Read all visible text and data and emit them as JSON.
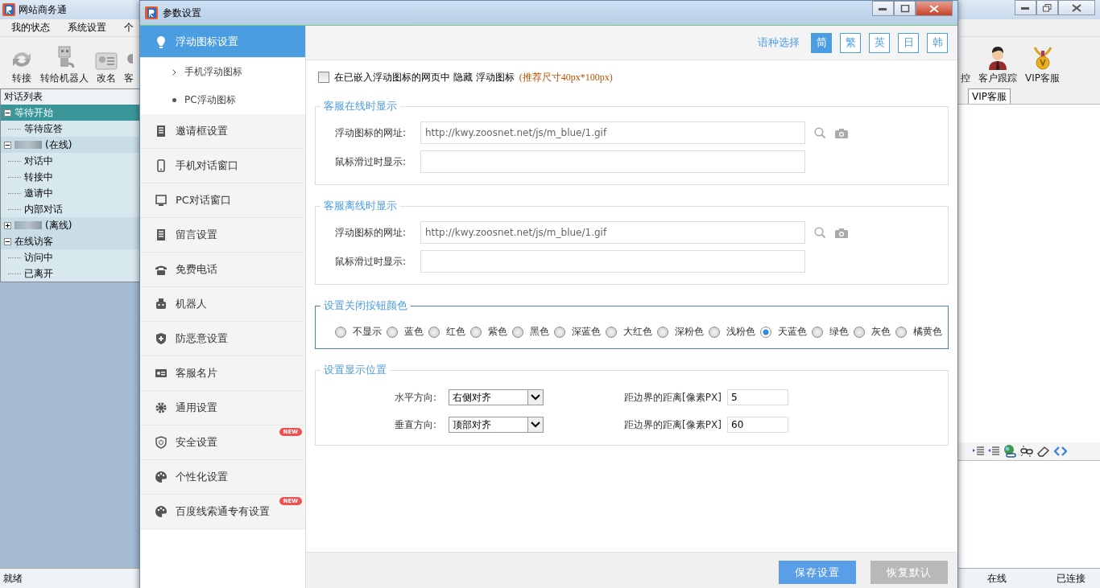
{
  "main_window": {
    "title": "网站商务通",
    "menu": [
      "我的状态",
      "系统设置",
      "个"
    ],
    "toolbar": [
      "转接",
      "转给机器人",
      "改名",
      "客"
    ],
    "toolbar_right": [
      "控",
      "客户跟踪",
      "VIP客服"
    ],
    "conversation_panel": {
      "title": "对话列表",
      "tree": [
        {
          "label": "等待开始",
          "expanded": true,
          "selected": true,
          "redacted": false,
          "children": [
            {
              "label": "等待应答"
            }
          ]
        },
        {
          "label": "(在线)",
          "expanded": true,
          "selected": false,
          "redacted": true,
          "children": [
            {
              "label": "对话中"
            },
            {
              "label": "转接中"
            },
            {
              "label": "邀请中"
            },
            {
              "label": "内部对话"
            }
          ]
        },
        {
          "label": "(离线)",
          "expanded": false,
          "selected": false,
          "redacted": true
        },
        {
          "label": "在线访客",
          "expanded": true,
          "selected": false,
          "redacted": false,
          "children": [
            {
              "label": "访问中"
            },
            {
              "label": "已离开"
            }
          ]
        }
      ]
    },
    "tab": "VIP客服",
    "status_bar": {
      "state": "就绪",
      "presence": "在线",
      "connection": "已连接"
    }
  },
  "dialog": {
    "title": "参数设置",
    "sidebar": [
      {
        "label": "浮动图标设置",
        "selected": true,
        "children": [
          {
            "label": "手机浮动图标",
            "selected": false
          },
          {
            "label": "PC浮动图标",
            "selected": true
          }
        ]
      },
      {
        "label": "邀请框设置",
        "selected": false
      },
      {
        "label": "手机对话窗口",
        "selected": false
      },
      {
        "label": "PC对话窗口",
        "selected": false
      },
      {
        "label": "留言设置",
        "selected": false
      },
      {
        "label": "免费电话",
        "selected": false
      },
      {
        "label": "机器人",
        "selected": false
      },
      {
        "label": "防恶意设置",
        "selected": false
      },
      {
        "label": "客服名片",
        "selected": false
      },
      {
        "label": "通用设置",
        "selected": false
      },
      {
        "label": "安全设置",
        "selected": false,
        "badge": "NEW"
      },
      {
        "label": "个性化设置",
        "selected": false
      },
      {
        "label": "百度线索通专有设置",
        "selected": false,
        "badge": "NEW"
      }
    ],
    "language": {
      "label": "语种选择",
      "options": [
        {
          "label": "简",
          "selected": true
        },
        {
          "label": "繁",
          "selected": false
        },
        {
          "label": "英",
          "selected": false
        },
        {
          "label": "日",
          "selected": false
        },
        {
          "label": "韩",
          "selected": false
        }
      ]
    },
    "hide_icon": {
      "checked": false,
      "label": "在已嵌入浮动图标的网页中 隐藏 浮动图标",
      "hint": "(推荐尺寸40px*100px)"
    },
    "online": {
      "title": "客服在线时显示",
      "focused": false,
      "url_label": "浮动图标的网址:",
      "url": "http://kwy.zoosnet.net/js/m_blue/1.gif",
      "hover_label": "鼠标滑过时显示:"
    },
    "offline": {
      "title": "客服离线时显示",
      "focused": false,
      "url_label": "浮动图标的网址:",
      "url": "http://kwy.zoosnet.net/js/m_blue/1.gif",
      "hover_label": "鼠标滑过时显示:"
    },
    "close_color": {
      "title": "设置关闭按钮颜色",
      "focused": true,
      "options": [
        {
          "label": "不显示",
          "selected": false
        },
        {
          "label": "蓝色",
          "selected": false
        },
        {
          "label": "红色",
          "selected": false
        },
        {
          "label": "紫色",
          "selected": false
        },
        {
          "label": "黑色",
          "selected": false
        },
        {
          "label": "深蓝色",
          "selected": false
        },
        {
          "label": "大红色",
          "selected": false
        },
        {
          "label": "深粉色",
          "selected": false
        },
        {
          "label": "浅粉色",
          "selected": false
        },
        {
          "label": "天蓝色",
          "selected": true
        },
        {
          "label": "绿色",
          "selected": false
        },
        {
          "label": "灰色",
          "selected": false
        },
        {
          "label": "橘黄色",
          "selected": false
        }
      ]
    },
    "position": {
      "title": "设置显示位置",
      "focused": false,
      "rows": [
        {
          "label": "水平方向:",
          "value": "右侧对齐",
          "distance_label": "距边界的距离[像素PX]",
          "distance": "5"
        },
        {
          "label": "垂直方向:",
          "value": "顶部对齐",
          "distance_label": "距边界的距离[像素PX]",
          "distance": "60"
        }
      ]
    },
    "buttons": [
      {
        "label": "保存设置",
        "disabled": false
      },
      {
        "label": "恢复默认",
        "disabled": true
      }
    ]
  }
}
